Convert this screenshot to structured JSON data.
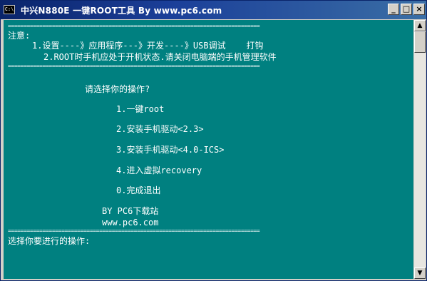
{
  "window": {
    "title": "中兴N880E 一键ROOT工具 By www.pc6.com",
    "icon_label": "C:\\",
    "controls": {
      "minimize": "_",
      "maximize": "□",
      "close": "×"
    }
  },
  "console": {
    "separator": "================================================================================",
    "notes_header": "注意:",
    "note_1": "1.设置----》应用程序---》开发----》USB调试    打钩",
    "note_2": "2.ROOT时手机应处于开机状态.请关闭电脑端的手机管理软件",
    "menu_prompt": "请选择你的操作?",
    "menu_items": [
      "1.一键root",
      "2.安装手机驱动<2.3>",
      "3.安装手机驱动<4.0-ICS>",
      "4.进入虚拟recovery",
      "0.完成退出"
    ],
    "brand_line": "BY PC6下载站",
    "brand_url": "www.pc6.com",
    "input_prompt": "选择你要进行的操作:"
  },
  "scrollbar": {
    "up_arrow": "▲",
    "down_arrow": "▼"
  }
}
